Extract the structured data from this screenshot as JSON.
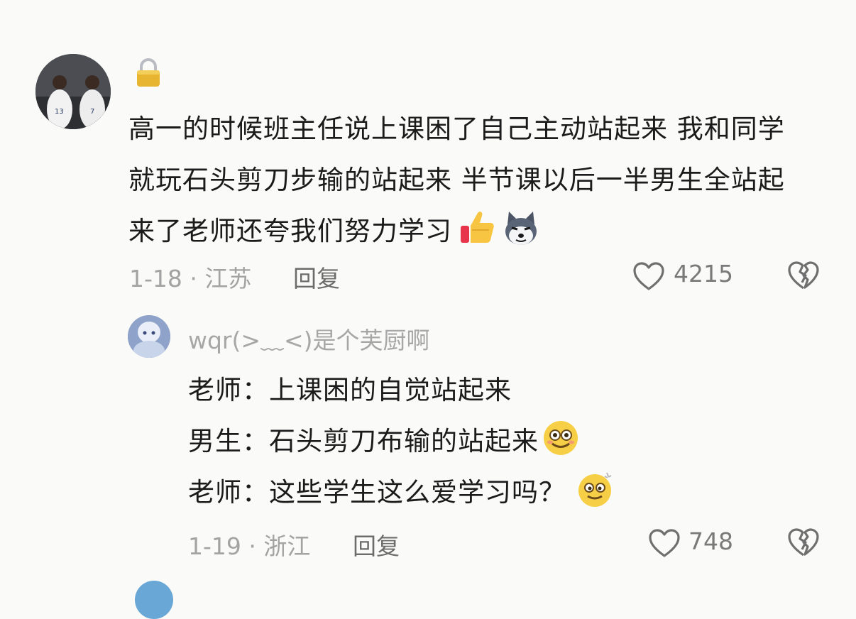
{
  "comment": {
    "lock_icon": "lock-icon",
    "text": "高一的时候班主任说上课困了自己主动站起来 我和同学就玩石头剪刀步输的站起来 半节课以后一半男生全站起来了老师还夸我们努力学习",
    "emojis": [
      "thumbs-up-icon",
      "husky-dog-icon"
    ],
    "meta": "1-18 · 江苏",
    "reply_label": "回复",
    "likes": "4215"
  },
  "reply": {
    "username": "wqr(>﹏<)是个芙厨啊",
    "lines": [
      "老师：上课困的自觉站起来",
      "男生：石头剪刀布输的站起来",
      "老师：这些学生这么爱学习吗？"
    ],
    "line_emojis": [
      "",
      "smiling-face-icon",
      "dizzy-face-icon"
    ],
    "meta": "1-19 · 浙江",
    "reply_label": "回复",
    "likes": "748"
  }
}
